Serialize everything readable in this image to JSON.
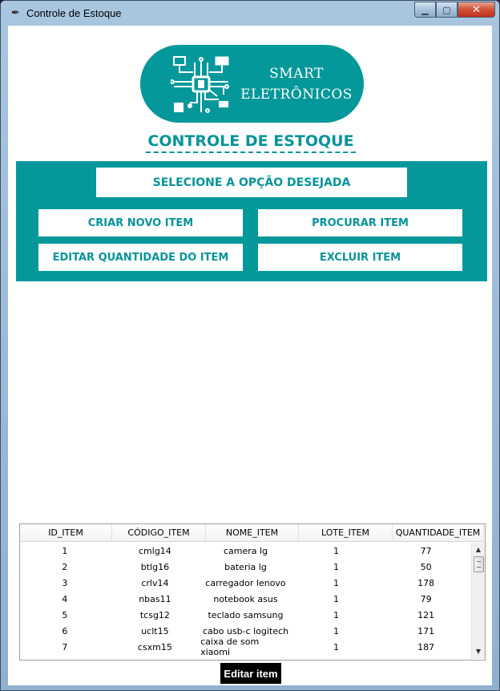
{
  "window": {
    "title": "Controle de Estoque",
    "app_icon": "feather-icon"
  },
  "logo": {
    "line1": "SMART",
    "line2": "ELETRÔNICOS",
    "color": "#05989a"
  },
  "page": {
    "title": "CONTROLE DE ESTOQUE"
  },
  "menu": {
    "banner": "SELECIONE A OPÇÃO DESEJADA",
    "create": "CRIAR NOVO ITEM",
    "search": "PROCURAR ITEM",
    "edit_qty": "EDITAR QUANTIDADE DO ITEM",
    "delete": "EXCLUIR ITEM"
  },
  "table": {
    "columns": [
      "ID_ITEM",
      "CÓDIGO_ITEM",
      "NOME_ITEM",
      "LOTE_ITEM",
      "QUANTIDADE_ITEM"
    ],
    "rows": [
      [
        "1",
        "cmlg14",
        "camera lg",
        "1",
        "77"
      ],
      [
        "2",
        "btlg16",
        "bateria lg",
        "1",
        "50"
      ],
      [
        "3",
        "crlv14",
        "carregador lenovo",
        "1",
        "178"
      ],
      [
        "4",
        "nbas11",
        "notebook asus",
        "1",
        "79"
      ],
      [
        "5",
        "tcsg12",
        "teclado samsung",
        "1",
        "121"
      ],
      [
        "6",
        "uclt15",
        "cabo usb-c logitech",
        "1",
        "171"
      ],
      [
        "7",
        "csxm15",
        "caixa de som xiaomi",
        "1",
        "187"
      ]
    ]
  },
  "actions": {
    "edit": "Editar item"
  }
}
